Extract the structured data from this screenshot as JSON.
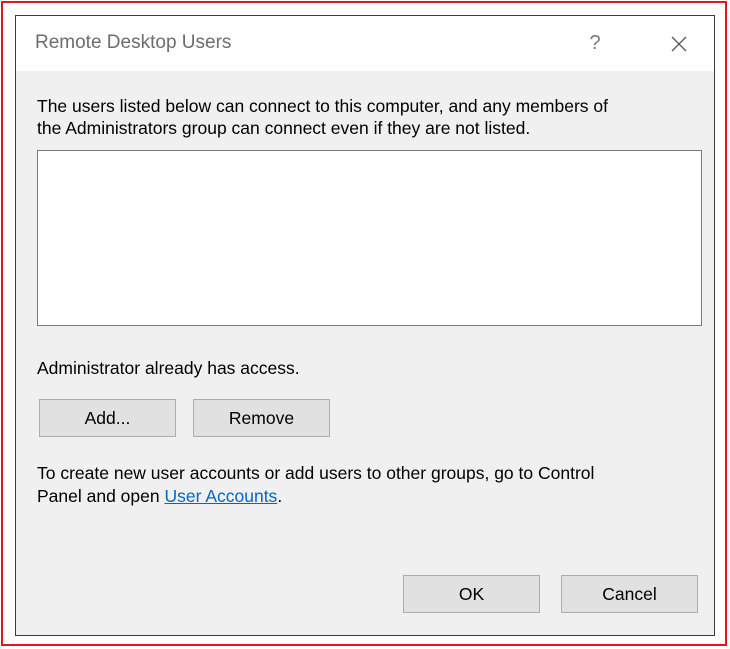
{
  "window": {
    "title": "Remote Desktop Users",
    "help_label": "?",
    "close_label": "Close"
  },
  "description": {
    "line1": "The users listed below can connect to this computer, and any members of",
    "line2": "the Administrators group can connect even if they are not listed."
  },
  "user_list": {
    "items": []
  },
  "access_note": "Administrator already has access.",
  "buttons": {
    "add_label": "Add...",
    "remove_label": "Remove",
    "ok_label": "OK",
    "cancel_label": "Cancel"
  },
  "footer": {
    "line1": "To create new user accounts or add users to other groups, go to Control",
    "line2_prefix": "Panel and open ",
    "link_label": "User Accounts",
    "line2_suffix": "."
  },
  "colors": {
    "highlight_frame": "#e0181b",
    "dialog_background": "#f0f0f0",
    "link": "#0066cc"
  },
  "icons": {
    "close": "close-icon"
  }
}
